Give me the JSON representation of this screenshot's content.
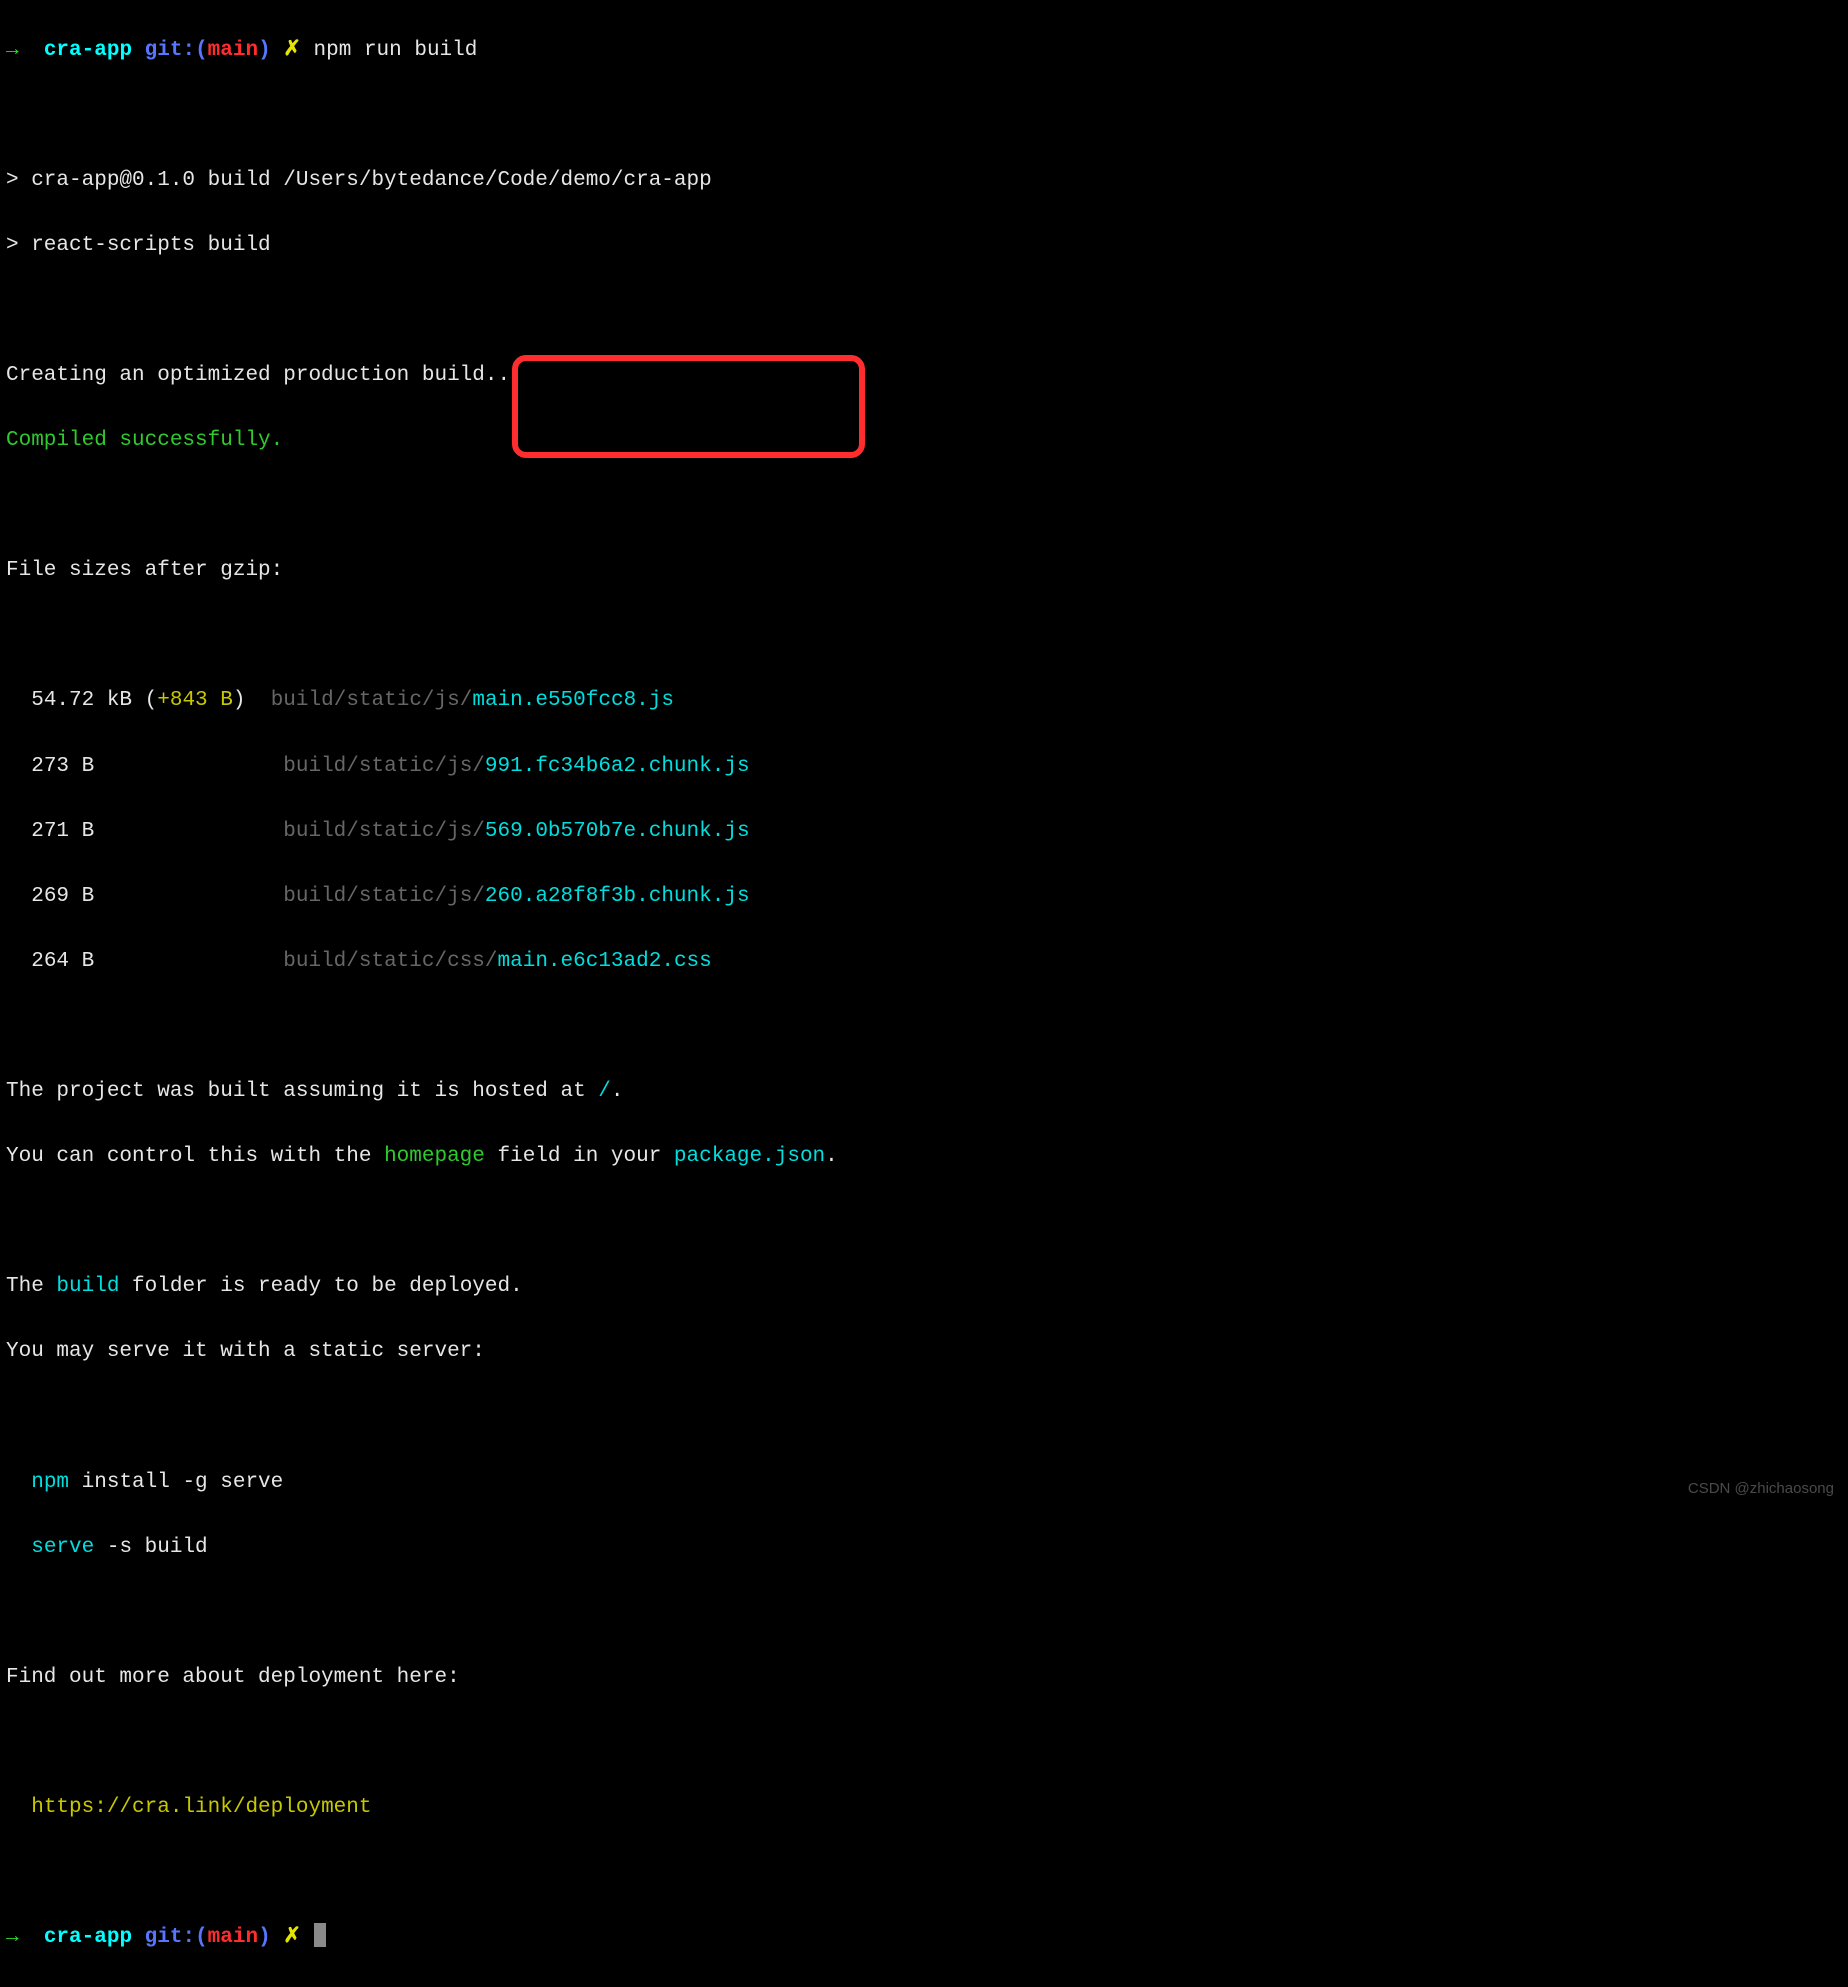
{
  "prompt1": {
    "arrow": "→",
    "dir": "cra-app",
    "git_label": "git:(",
    "branch": "main",
    "git_close": ")",
    "dirty": "✗",
    "command": "npm run build"
  },
  "output": {
    "line1": "> cra-app@0.1.0 build /Users/bytedance/Code/demo/cra-app",
    "line2": "> react-scripts build",
    "creating": "Creating an optimized production build...",
    "compiled": "Compiled successfully.",
    "file_sizes_header": "File sizes after gzip:",
    "files": [
      {
        "size": "54.72 kB ",
        "delta_open": "(",
        "delta": "+843 B",
        "delta_close": ")",
        "path_prefix": "build/static/js/",
        "file": "main.e550fcc8.js"
      },
      {
        "size": "273 B",
        "path_prefix": "build/static/js/",
        "file": "991.fc34b6a2.chunk.js"
      },
      {
        "size": "271 B",
        "path_prefix": "build/static/js/",
        "file": "569.0b570b7e.chunk.js"
      },
      {
        "size": "269 B",
        "path_prefix": "build/static/js/",
        "file": "260.a28f8f3b.chunk.js"
      },
      {
        "size": "264 B",
        "path_prefix": "build/static/css/",
        "file": "main.e6c13ad2.css"
      }
    ],
    "hosted_pre": "The project was built assuming it is hosted at ",
    "hosted_slash": "/",
    "hosted_post": ".",
    "control_pre": "You can control this with the ",
    "homepage": "homepage",
    "control_mid": " field in your ",
    "pkgjson": "package.json",
    "control_post": ".",
    "ready_pre": "The ",
    "build_word": "build",
    "ready_post": " folder is ready to be deployed.",
    "serve_hint": "You may serve it with a static server:",
    "npm_word": "npm",
    "npm_install_rest": " install -g serve",
    "serve_word": "serve",
    "serve_rest": " -s build",
    "deploy_more": "Find out more about deployment here:",
    "deploy_link": "https://cra.link/deployment"
  },
  "prompt2": {
    "arrow": "→",
    "dir": "cra-app",
    "git_label": "git:(",
    "branch": "main",
    "git_close": ")",
    "dirty": "✗"
  },
  "watermark": "CSDN @zhichaosong"
}
